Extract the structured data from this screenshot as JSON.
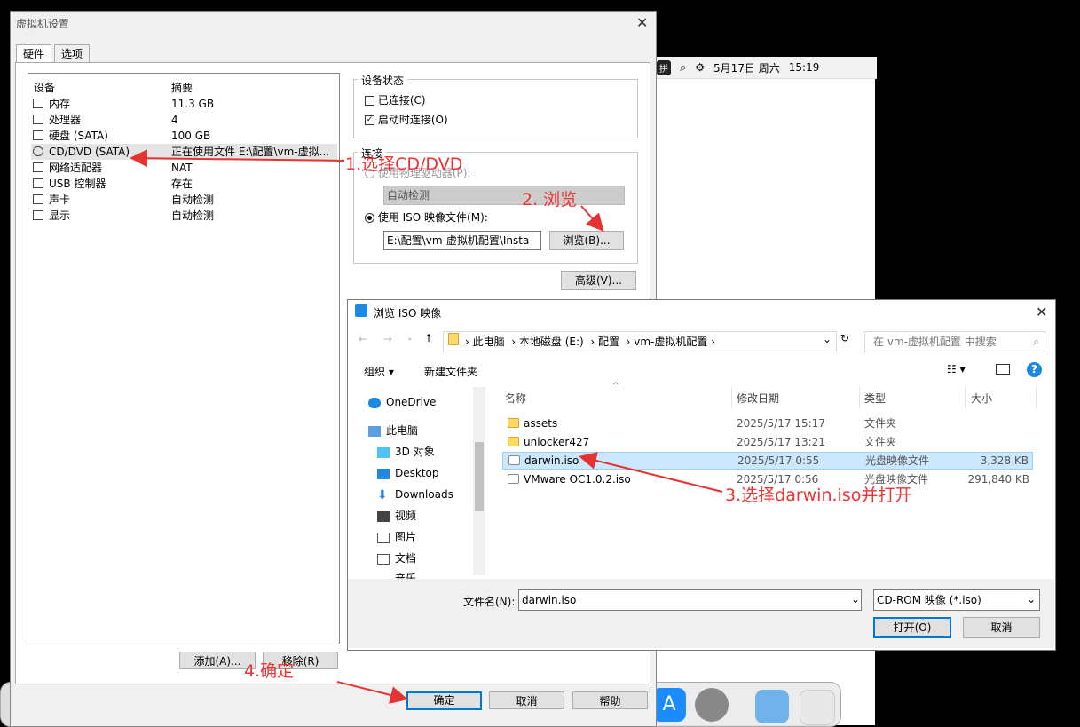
{
  "mac": {
    "input_method": "拼",
    "date": "5月17日 周六",
    "time": "15:19"
  },
  "settings": {
    "title": "虚拟机设置",
    "tabs": [
      "硬件",
      "选项"
    ],
    "columns": {
      "device": "设备",
      "summary": "摘要"
    },
    "devices": [
      {
        "name": "内存",
        "summary": "11.3 GB",
        "icon": "memory-icon"
      },
      {
        "name": "处理器",
        "summary": "4",
        "icon": "cpu-icon"
      },
      {
        "name": "硬盘 (SATA)",
        "summary": "100 GB",
        "icon": "disk-icon"
      },
      {
        "name": "CD/DVD (SATA)",
        "summary": "正在使用文件 E:\\配置\\vm-虚拟...",
        "icon": "cd-icon"
      },
      {
        "name": "网络适配器",
        "summary": "NAT",
        "icon": "network-icon"
      },
      {
        "name": "USB 控制器",
        "summary": "存在",
        "icon": "usb-icon"
      },
      {
        "name": "声卡",
        "summary": "自动检测",
        "icon": "sound-icon"
      },
      {
        "name": "显示",
        "summary": "自动检测",
        "icon": "display-icon"
      }
    ],
    "device_status": {
      "title": "设备状态",
      "connected": "已连接(C)",
      "connect_on_power": "启动时连接(O)"
    },
    "connection": {
      "title": "连接",
      "physical": "使用物理驱动器(P):",
      "auto_detect": "自动检测",
      "use_iso": "使用 ISO 映像文件(M):",
      "iso_path": "E:\\配置\\vm-虚拟机配置\\Insta",
      "browse": "浏览(B)...",
      "advanced": "高级(V)..."
    },
    "buttons": {
      "add": "添加(A)...",
      "remove": "移除(R)",
      "ok": "确定",
      "cancel": "取消",
      "help": "帮助"
    }
  },
  "iso_dialog": {
    "title": "浏览 ISO 映像",
    "breadcrumb": [
      "此电脑",
      "本地磁盘 (E:)",
      "配置",
      "vm-虚拟机配置"
    ],
    "search_placeholder": "在 vm-虚拟机配置 中搜索",
    "organize": "组织 ▾",
    "new_folder": "新建文件夹",
    "nav": [
      "OneDrive",
      "此电脑",
      "3D 对象",
      "Desktop",
      "Downloads",
      "视频",
      "图片",
      "文档",
      "音乐"
    ],
    "columns": [
      "名称",
      "修改日期",
      "类型",
      "大小"
    ],
    "files": [
      {
        "name": "assets",
        "date": "2025/5/17 15:17",
        "type": "文件夹",
        "size": ""
      },
      {
        "name": "unlocker427",
        "date": "2025/5/17 13:21",
        "type": "文件夹",
        "size": ""
      },
      {
        "name": "darwin.iso",
        "date": "2025/5/17 0:55",
        "type": "光盘映像文件",
        "size": "3,328 KB"
      },
      {
        "name": "VMware OC1.0.2.iso",
        "date": "2025/5/17 0:56",
        "type": "光盘映像文件",
        "size": "291,840 KB"
      }
    ],
    "filename_label": "文件名(N):",
    "filename_value": "darwin.iso",
    "filter": "CD-ROM 映像 (*.iso)",
    "open": "打开(O)",
    "cancel": "取消"
  },
  "annotations": {
    "step1": "1.选择CD/DVD",
    "step2": "2. 浏览",
    "step3": "3.选择darwin.iso并打开",
    "step4": "4.确定",
    "color": "#e53333"
  }
}
